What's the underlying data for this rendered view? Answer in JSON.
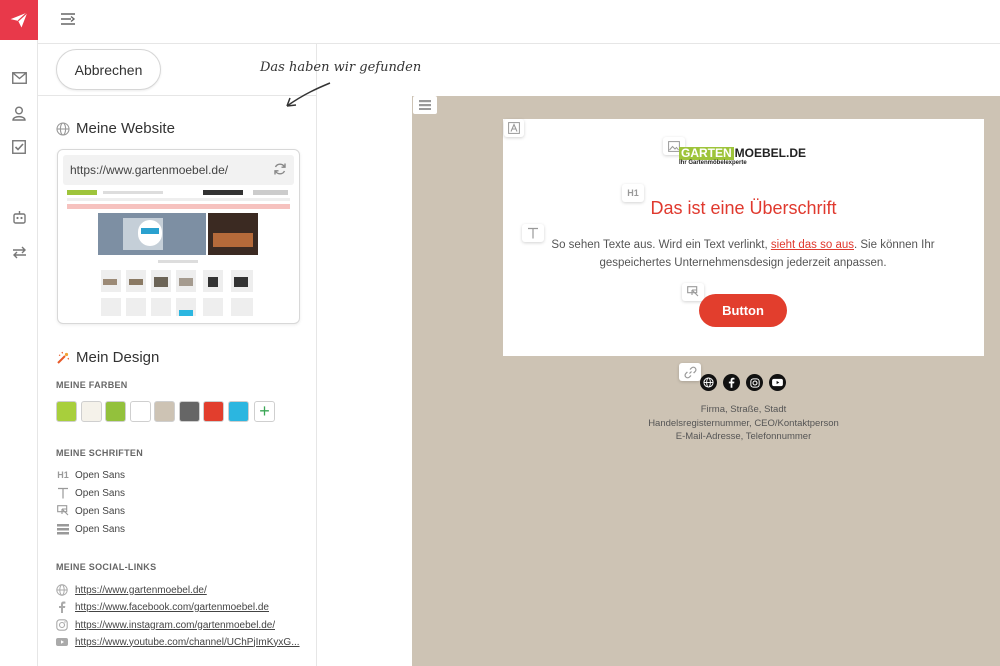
{
  "topbar": {},
  "panel": {
    "cancel_label": "Abbrechen",
    "annotation": "Das haben wir gefunden",
    "website": {
      "title": "Meine Website",
      "url": "https://www.gartenmoebel.de/"
    },
    "design": {
      "title": "Mein Design",
      "colors_label": "MEINE FARBEN",
      "colors": [
        "#a8cf3c",
        "#f5f2ea",
        "#93c13c",
        "#ffffff",
        "#cdc3b4",
        "#666666",
        "#e23e2d",
        "#2bb6e0"
      ],
      "fonts_label": "MEINE SCHRIFTEN",
      "fonts": [
        {
          "icon": "heading-icon",
          "name": "Open Sans"
        },
        {
          "icon": "text-icon",
          "name": "Open Sans"
        },
        {
          "icon": "button-icon",
          "name": "Open Sans"
        },
        {
          "icon": "footer-icon",
          "name": "Open Sans"
        }
      ],
      "social_label": "MEINE SOCIAL-LINKS",
      "social": [
        {
          "icon": "globe-icon",
          "url": "https://www.gartenmoebel.de/"
        },
        {
          "icon": "facebook-icon",
          "url": "https://www.facebook.com/gartenmoebel.de"
        },
        {
          "icon": "instagram-icon",
          "url": "https://www.instagram.com/gartenmoebel.de/"
        },
        {
          "icon": "youtube-icon",
          "url": "https://www.youtube.com/channel/UChPjImKyxG..."
        }
      ]
    }
  },
  "preview": {
    "logo_part1": "GARTEN",
    "logo_part2": "MOEBEL.DE",
    "logo_sub": "Ihr Gartenmöbelexperte",
    "tool_h1": "H1",
    "headline": "Das ist eine Überschrift",
    "body_before": "So sehen Texte aus. Wird ein Text verlinkt, ",
    "body_link": "sieht das so aus",
    "body_after": ". Sie können Ihr gespeichertes Unternehmensdesign jederzeit anpassen.",
    "button_label": "Button",
    "footer_line1": "Firma, Straße, Stadt",
    "footer_line2": "Handelsregisternummer, CEO/Kontaktperson",
    "footer_line3": "E-Mail-Adresse, Telefonnummer"
  }
}
